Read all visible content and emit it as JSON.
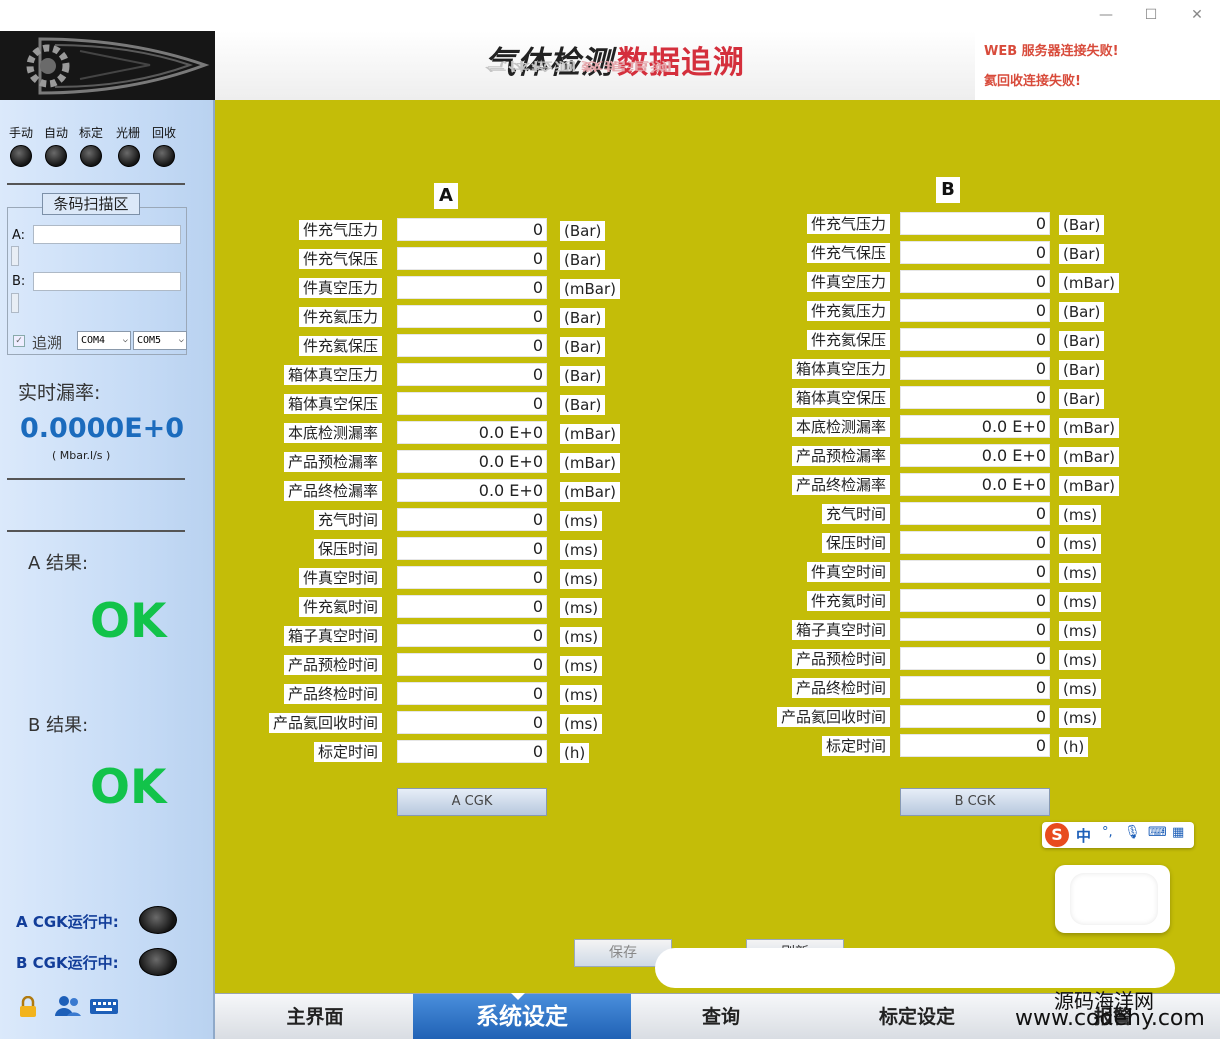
{
  "window": {
    "minimize": "—",
    "maximize": "☐",
    "close": "✕"
  },
  "header": {
    "title_part1": "气体检测",
    "title_part2": "数据追溯",
    "status1": "WEB 服务器连接失败!",
    "status2": "氦回收连接失败!"
  },
  "sidebar": {
    "modes": [
      "手动",
      "自动",
      "标定",
      "光栅",
      "回收"
    ],
    "scan_legend": "条码扫描区",
    "scan_a_label": "A:",
    "scan_b_label": "B:",
    "scan_a_value": "",
    "scan_b_value": "",
    "trace_label": "追溯",
    "com1": "COM4",
    "com2": "COM5",
    "realtime_label": "实时漏率:",
    "realtime_value": "0.0000E+0",
    "realtime_unit": "( Mbar.l/s )",
    "result_a_label": "A 结果:",
    "result_a_value": "OK",
    "result_b_label": "B 结果:",
    "result_b_value": "OK",
    "cgk_a_label": "A CGK运行中:",
    "cgk_b_label": "B CGK运行中:",
    "icons": [
      "lock-icon",
      "users-icon",
      "keyboard-icon"
    ]
  },
  "panel_a": {
    "header": "A",
    "rows": [
      {
        "label": "件充气压力",
        "value": "0",
        "unit": "(Bar)"
      },
      {
        "label": "件充气保压",
        "value": "0",
        "unit": "(Bar)"
      },
      {
        "label": "件真空压力",
        "value": "0",
        "unit": "(mBar)"
      },
      {
        "label": "件充氦压力",
        "value": "0",
        "unit": "(Bar)"
      },
      {
        "label": "件充氦保压",
        "value": "0",
        "unit": "(Bar)"
      },
      {
        "label": "箱体真空压力",
        "value": "0",
        "unit": "(Bar)"
      },
      {
        "label": "箱体真空保压",
        "value": "0",
        "unit": "(Bar)"
      },
      {
        "label": "本底检测漏率",
        "value": "0.0 E+0",
        "unit": "(mBar)"
      },
      {
        "label": "产品预检漏率",
        "value": "0.0 E+0",
        "unit": "(mBar)"
      },
      {
        "label": "产品终检漏率",
        "value": "0.0 E+0",
        "unit": "(mBar)"
      },
      {
        "label": "充气时间",
        "value": "0",
        "unit": "(ms)"
      },
      {
        "label": "保压时间",
        "value": "0",
        "unit": "(ms)"
      },
      {
        "label": "件真空时间",
        "value": "0",
        "unit": "(ms)"
      },
      {
        "label": "件充氦时间",
        "value": "0",
        "unit": "(ms)"
      },
      {
        "label": "箱子真空时间",
        "value": "0",
        "unit": "(ms)"
      },
      {
        "label": "产品预检时间",
        "value": "0",
        "unit": "(ms)"
      },
      {
        "label": "产品终检时间",
        "value": "0",
        "unit": "(ms)"
      },
      {
        "label": "产品氦回收时间",
        "value": "0",
        "unit": "(ms)"
      },
      {
        "label": "标定时间",
        "value": "0",
        "unit": "(h)"
      }
    ],
    "cgk_button": "A CGK"
  },
  "panel_b": {
    "header": "B",
    "rows": [
      {
        "label": "件充气压力",
        "value": "0",
        "unit": "(Bar)"
      },
      {
        "label": "件充气保压",
        "value": "0",
        "unit": "(Bar)"
      },
      {
        "label": "件真空压力",
        "value": "0",
        "unit": "(mBar)"
      },
      {
        "label": "件充氦压力",
        "value": "0",
        "unit": "(Bar)"
      },
      {
        "label": "件充氦保压",
        "value": "0",
        "unit": "(Bar)"
      },
      {
        "label": "箱体真空压力",
        "value": "0",
        "unit": "(Bar)"
      },
      {
        "label": "箱体真空保压",
        "value": "0",
        "unit": "(Bar)"
      },
      {
        "label": "本底检测漏率",
        "value": "0.0 E+0",
        "unit": "(mBar)"
      },
      {
        "label": "产品预检漏率",
        "value": "0.0 E+0",
        "unit": "(mBar)"
      },
      {
        "label": "产品终检漏率",
        "value": "0.0 E+0",
        "unit": "(mBar)"
      },
      {
        "label": "充气时间",
        "value": "0",
        "unit": "(ms)"
      },
      {
        "label": "保压时间",
        "value": "0",
        "unit": "(ms)"
      },
      {
        "label": "件真空时间",
        "value": "0",
        "unit": "(ms)"
      },
      {
        "label": "件充氦时间",
        "value": "0",
        "unit": "(ms)"
      },
      {
        "label": "箱子真空时间",
        "value": "0",
        "unit": "(ms)"
      },
      {
        "label": "产品预检时间",
        "value": "0",
        "unit": "(ms)"
      },
      {
        "label": "产品终检时间",
        "value": "0",
        "unit": "(ms)"
      },
      {
        "label": "产品氦回收时间",
        "value": "0",
        "unit": "(ms)"
      },
      {
        "label": "标定时间",
        "value": "0",
        "unit": "(h)"
      }
    ],
    "cgk_button": "B CGK"
  },
  "actions": {
    "save": "保存",
    "refresh": "刷新"
  },
  "ime": {
    "logo": "S",
    "lang": "中",
    "punct": "°,",
    "mic": "🎙",
    "keyboard": "⌨",
    "menu": "▦"
  },
  "nav": {
    "tabs": [
      "主界面",
      "系统设定",
      "查询",
      "标定设定",
      "报警"
    ],
    "active": "系统设定"
  },
  "watermark": {
    "line1": "源码海洋网",
    "line2": "www.codehy.com"
  },
  "colors": {
    "panel": "#c4bd08",
    "ok": "#12c34a",
    "accent": "#1f61b4",
    "warn": "#d84b3b"
  }
}
